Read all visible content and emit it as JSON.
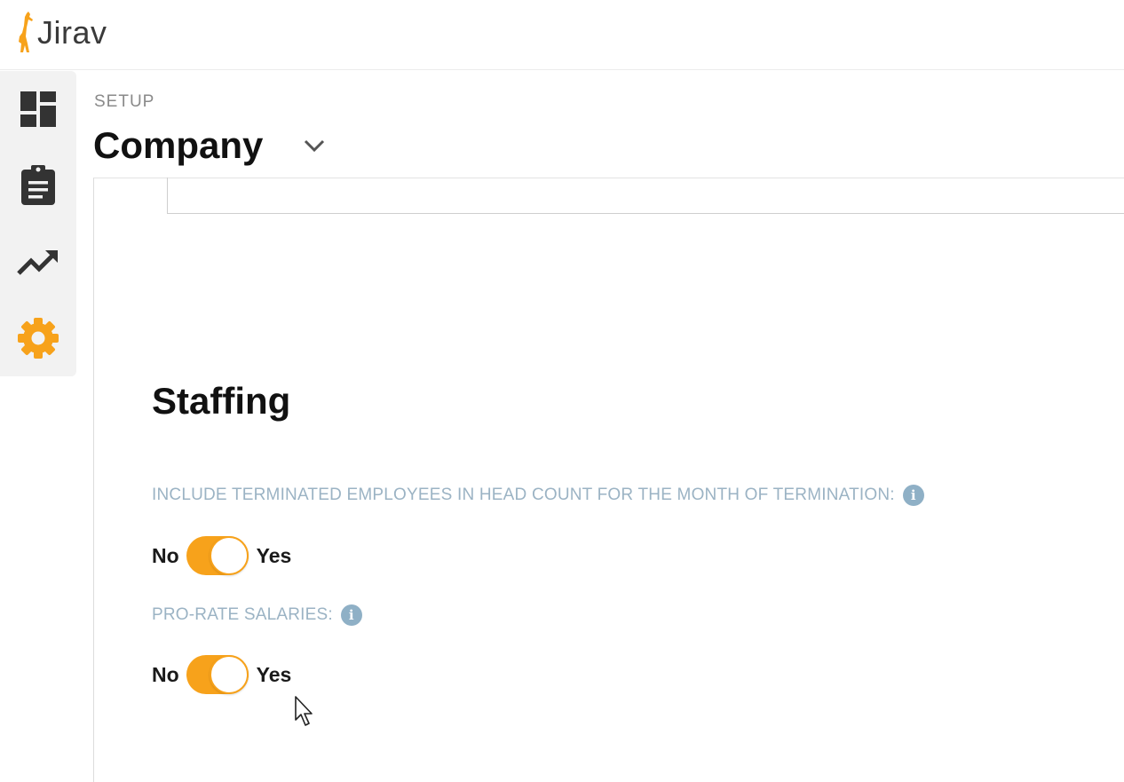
{
  "app": {
    "brand": "Jirav",
    "accent_color": "#f7a21b"
  },
  "sidebar": {
    "items": [
      {
        "icon": "dashboard-icon",
        "active": false
      },
      {
        "icon": "clipboard-icon",
        "active": false
      },
      {
        "icon": "trending-up-icon",
        "active": false
      },
      {
        "icon": "gear-icon",
        "active": true
      }
    ]
  },
  "header": {
    "section": "SETUP",
    "title": "Company"
  },
  "staffing": {
    "title": "Staffing",
    "settings": [
      {
        "label": "INCLUDE TERMINATED EMPLOYEES IN HEAD COUNT FOR THE MONTH OF TERMINATION:",
        "off_label": "No",
        "on_label": "Yes",
        "value": "Yes"
      },
      {
        "label": "PRO-RATE SALARIES:",
        "off_label": "No",
        "on_label": "Yes",
        "value": "Yes"
      }
    ]
  },
  "info_glyph": "i"
}
